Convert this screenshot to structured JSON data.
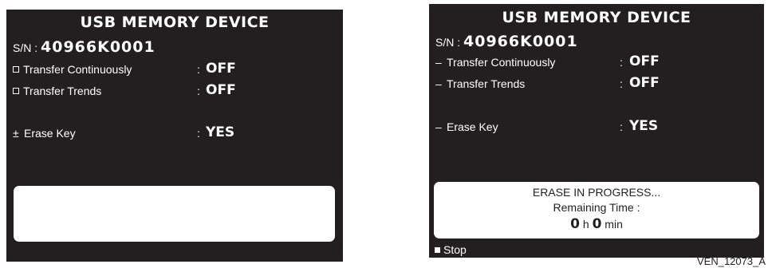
{
  "left_screen": {
    "title": "USB MEMORY DEVICE",
    "sn_label": "S/N : ",
    "sn_value": "40966K0001",
    "rows": [
      {
        "marker": "checkbox",
        "label": "Transfer Continuously",
        "value": "OFF"
      },
      {
        "marker": "checkbox",
        "label": "Transfer Trends",
        "value": "OFF"
      },
      {
        "marker": "±",
        "label": "Erase Key",
        "value": "YES"
      }
    ],
    "colon": ":"
  },
  "right_screen": {
    "title": "USB MEMORY DEVICE",
    "sn_label": "S/N : ",
    "sn_value": "40966K0001",
    "rows": [
      {
        "marker": "–",
        "label": "Transfer Continuously",
        "value": "OFF"
      },
      {
        "marker": "–",
        "label": "Transfer Trends",
        "value": "OFF"
      },
      {
        "marker": "–",
        "label": "Erase Key",
        "value": "YES"
      }
    ],
    "colon": ":",
    "message": {
      "line1": "ERASE IN PROGRESS...",
      "line2": "Remaining Time :",
      "hours": "0",
      "hours_unit": "h",
      "minutes": "0",
      "minutes_unit": "min"
    },
    "stop_label": "Stop"
  },
  "figure_id": "VEN_12073_A",
  "colors": {
    "screen_bg": "#231f20",
    "text": "#ffffff",
    "box_bg": "#ffffff"
  }
}
